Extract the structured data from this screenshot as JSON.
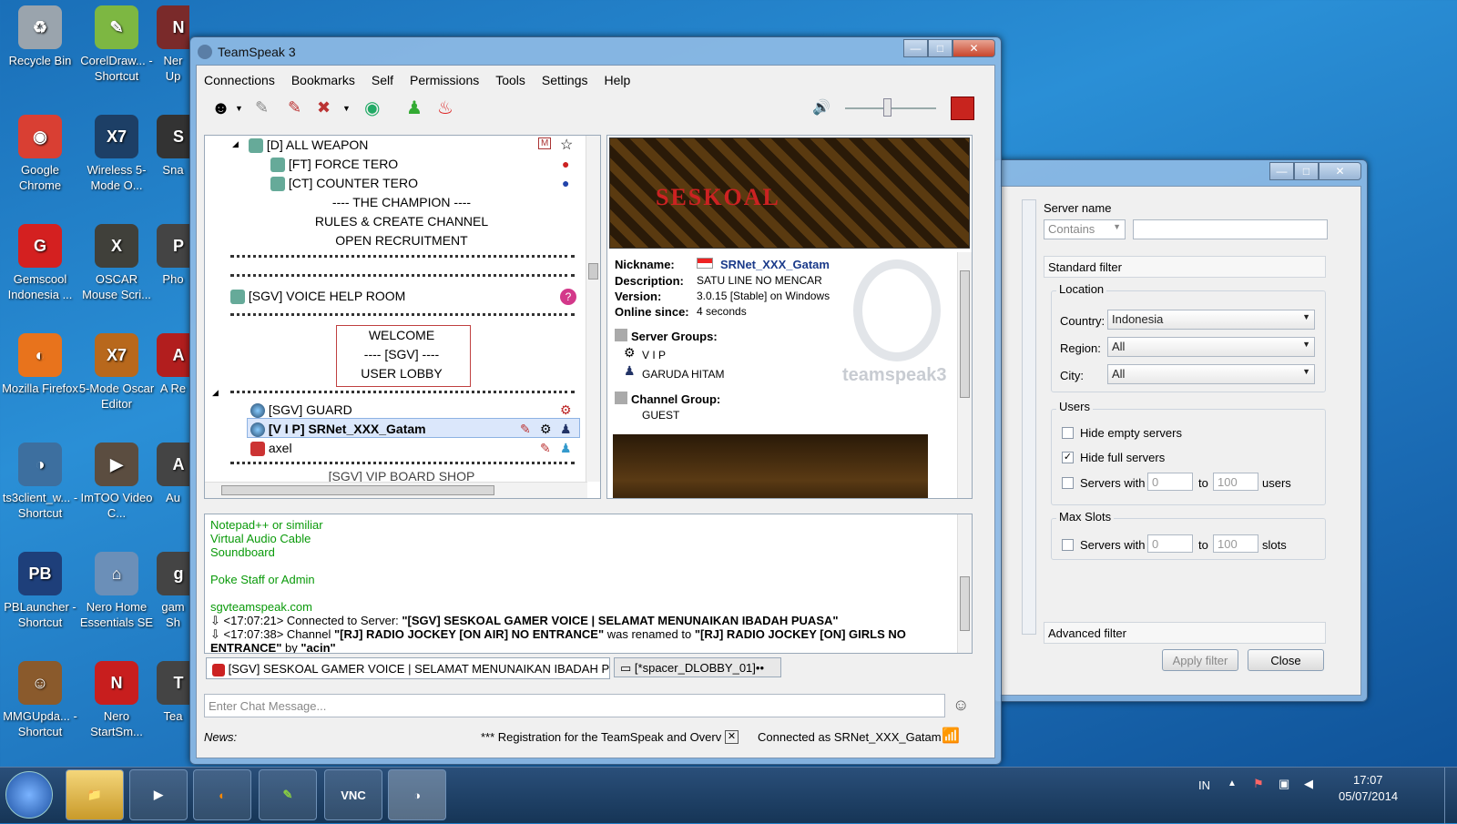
{
  "desktop": {
    "icons": [
      {
        "label": "Recycle Bin",
        "color": "#9aa4ad",
        "glyph": "♻"
      },
      {
        "label": "CorelDraw... - Shortcut",
        "color": "#7db742",
        "glyph": "✎"
      },
      {
        "label": "Ner Up",
        "color": "#7a2a2a",
        "glyph": "N"
      },
      {
        "label": "Google Chrome",
        "color": "#d93f33",
        "glyph": "◉"
      },
      {
        "label": "Wireless 5-Mode O...",
        "color": "#1d3f66",
        "glyph": "X7"
      },
      {
        "label": "Sna",
        "color": "#333",
        "glyph": "S"
      },
      {
        "label": "Gemscool Indonesia ...",
        "color": "#d42020",
        "glyph": "G"
      },
      {
        "label": "OSCAR Mouse Scri...",
        "color": "#40403a",
        "glyph": "X"
      },
      {
        "label": "Pho",
        "color": "#444",
        "glyph": "P"
      },
      {
        "label": "Mozilla Firefox",
        "color": "#e8731c",
        "glyph": "◐"
      },
      {
        "label": "5-Mode Oscar Editor",
        "color": "#b8681c",
        "glyph": "X7"
      },
      {
        "label": "A Re",
        "color": "#b21e1e",
        "glyph": "A"
      },
      {
        "label": "ts3client_w... - Shortcut",
        "color": "#3d6f9f",
        "glyph": "◑"
      },
      {
        "label": "ImTOO Video C...",
        "color": "#5b4d40",
        "glyph": "▶"
      },
      {
        "label": "Au",
        "color": "#444",
        "glyph": "A"
      },
      {
        "label": "PBLauncher - Shortcut",
        "color": "#1e3f7a",
        "glyph": "PB"
      },
      {
        "label": "Nero Home Essentials SE",
        "color": "#6b8fb8",
        "glyph": "⌂"
      },
      {
        "label": "gam Sh",
        "color": "#444",
        "glyph": "g"
      },
      {
        "label": "MMGUpda... - Shortcut",
        "color": "#8a5a2c",
        "glyph": "☺"
      },
      {
        "label": "Nero StartSm...",
        "color": "#c81e1e",
        "glyph": "N"
      },
      {
        "label": "Tea",
        "color": "#444",
        "glyph": "T"
      }
    ]
  },
  "ts": {
    "title": "TeamSpeak 3",
    "menu": [
      "Connections",
      "Bookmarks",
      "Self",
      "Permissions",
      "Tools",
      "Settings",
      "Help"
    ],
    "tree": {
      "all_weapon": "[D] ALL WEAPON",
      "force_tero": "[FT] FORCE TERO",
      "counter_tero": "[CT] COUNTER TERO",
      "champion": "---- THE CHAMPION ----",
      "rules": "RULES & CREATE CHANNEL",
      "recruit": "OPEN RECRUITMENT",
      "voice_help": "[SGV] VOICE HELP ROOM",
      "welcome1": "WELCOME",
      "welcome2": "---- [SGV] ----",
      "welcome3": "USER LOBBY",
      "guard": "[SGV] GUARD",
      "vip": "[V I P] SRNet_XXX_Gatam",
      "axel": "axel",
      "partial": "[SGV] VIP BOARD SHOP"
    },
    "info": {
      "nickname_label": "Nickname:",
      "nickname": "SRNet_XXX_Gatam",
      "description_label": "Description:",
      "description": "SATU LINE NO MENCAR",
      "version_label": "Version:",
      "version": "3.0.15 [Stable] on Windows",
      "online_label": "Online since:",
      "online": "4 seconds",
      "server_groups_label": "Server Groups:",
      "group1": "V I P",
      "group2": "GARUDA HITAM",
      "channel_group_label": "Channel Group:",
      "channel_group": "GUEST",
      "banner_text": "SESKOAL",
      "watermark": "teamspeak3"
    },
    "chat": {
      "l1": "Notepad++ or similiar",
      "l2": "Virtual Audio Cable",
      "l3": "Soundboard",
      "l4": "Poke Staff or Admin",
      "l5": "sgvteamspeak.com",
      "l6a": "<17:07:21> Connected to Server: ",
      "l6b": "\"[SGV] SESKOAL GAMER VOICE | SELAMAT MENUNAIKAN IBADAH PUASA\"",
      "l7a": "<17:07:38> Channel ",
      "l7b": "\"[RJ] RADIO JOCKEY [ON AIR] NO ENTRANCE\"",
      "l7c": " was renamed to ",
      "l7d": "\"[RJ] RADIO JOCKEY [ON] GIRLS NO",
      "l8a": "ENTRANCE\"",
      "l8b": " by ",
      "l8c": "\"acin\""
    },
    "tabs": {
      "server": "[SGV] SESKOAL GAMER VOICE | SELAMAT MENUNAIKAN IBADAH PUASA",
      "channel": "[*spacer_DLOBBY_01]••"
    },
    "chat_placeholder": "Enter Chat Message...",
    "status": {
      "news_label": "News:",
      "news": "*** Registration for the TeamSpeak and Overv",
      "connected": "Connected as SRNet_XXX_Gatam"
    }
  },
  "filter": {
    "server_name_label": "Server name",
    "contains": "Contains",
    "standard": "Standard filter",
    "location": "Location",
    "country_label": "Country:",
    "country": "Indonesia",
    "region_label": "Region:",
    "region": "All",
    "city_label": "City:",
    "city": "All",
    "users": "Users",
    "hide_empty": "Hide empty servers",
    "hide_full": "Hide full servers",
    "servers_with": "Servers with",
    "to": "to",
    "users_unit": "users",
    "min_users": "0",
    "max_users": "100",
    "max_slots": "Max Slots",
    "servers_with2": "Servers with",
    "to2": "to",
    "slots_unit": "slots",
    "min_slots": "0",
    "max_slots_val": "100",
    "advanced": "Advanced filter",
    "apply": "Apply filter",
    "close": "Close"
  },
  "taskbar": {
    "lang": "IN",
    "time": "17:07",
    "date": "05/07/2014"
  }
}
